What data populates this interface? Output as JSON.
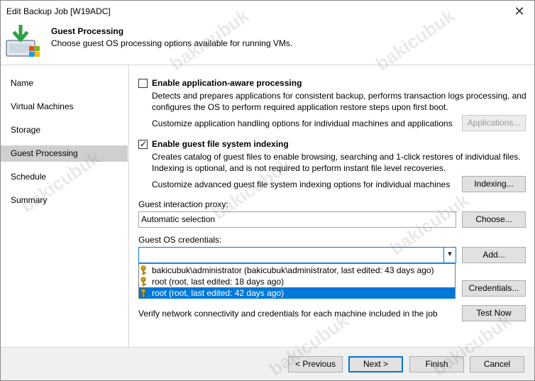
{
  "window": {
    "title": "Edit Backup Job [W19ADC]"
  },
  "header": {
    "title": "Guest Processing",
    "subtitle": "Choose guest OS processing options available for running VMs."
  },
  "sidebar": {
    "items": [
      {
        "label": "Name"
      },
      {
        "label": "Virtual Machines"
      },
      {
        "label": "Storage"
      },
      {
        "label": "Guest Processing",
        "active": true
      },
      {
        "label": "Schedule"
      },
      {
        "label": "Summary"
      }
    ]
  },
  "app_aware": {
    "checked": false,
    "label": "Enable application-aware processing",
    "desc1": "Detects and prepares applications for consistent backup, performs transaction logs processing, and",
    "desc2": "configures the OS to perform required application restore steps upon first boot.",
    "customize": "Customize application handling options for individual machines and applications",
    "button": "Applications..."
  },
  "indexing": {
    "checked": true,
    "label": "Enable guest file system indexing",
    "desc1": "Creates catalog of guest files to enable browsing, searching and 1-click restores of individual files.",
    "desc2": "Indexing is optional, and is not required to perform instant file level recoveries.",
    "customize": "Customize advanced guest file system indexing options for individual machines",
    "button": "Indexing..."
  },
  "proxy": {
    "label": "Guest interaction proxy:",
    "value": "Automatic selection",
    "button": "Choose..."
  },
  "credentials": {
    "label": "Guest OS credentials:",
    "value": "",
    "add_button": "Add...",
    "credentials_button": "Credentials...",
    "options": [
      "bakicubuk\\administrator (bakicubuk\\administrator, last edited: 43 days ago)",
      "root (root, last edited: 18 days ago)",
      "root (root, last edited: 42 days ago)"
    ],
    "selected_index": 2
  },
  "verify": {
    "text": "Verify network connectivity and credentials for each machine included in the job",
    "button": "Test Now"
  },
  "footer": {
    "previous": "< Previous",
    "next": "Next >",
    "finish": "Finish",
    "cancel": "Cancel"
  },
  "watermark": "bakicubuk",
  "colors": {
    "accent": "#0078d7",
    "sidebar_active": "#cfcfcf",
    "footer_bg": "#f0f0f0"
  }
}
